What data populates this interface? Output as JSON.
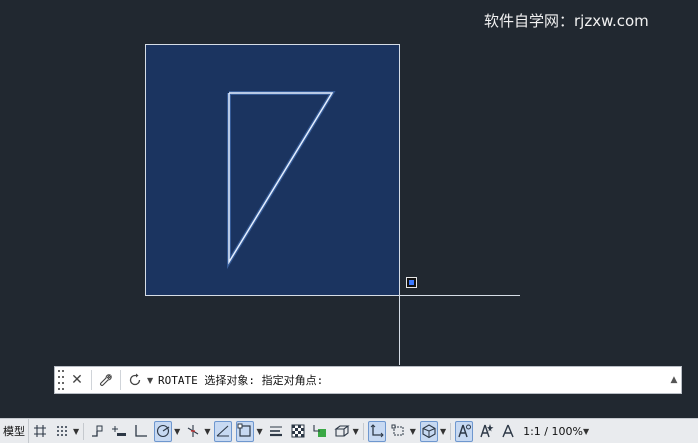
{
  "watermark": {
    "text": "软件自学网：rjzxw.com"
  },
  "command_line": {
    "text": "ROTATE 选择对象: 指定对角点:",
    "close_icon": "close-icon",
    "customize_icon": "wrench-icon",
    "recent_icon": "rotate-arrow-icon"
  },
  "status_bar": {
    "model_tab": "模型",
    "scale": "1:1 / 100%"
  },
  "colors": {
    "canvas_bg": "#212830",
    "selection_fill": "#1b3460",
    "entity_stroke": "#d6e6ff",
    "status_active": "#c7d9f2"
  }
}
